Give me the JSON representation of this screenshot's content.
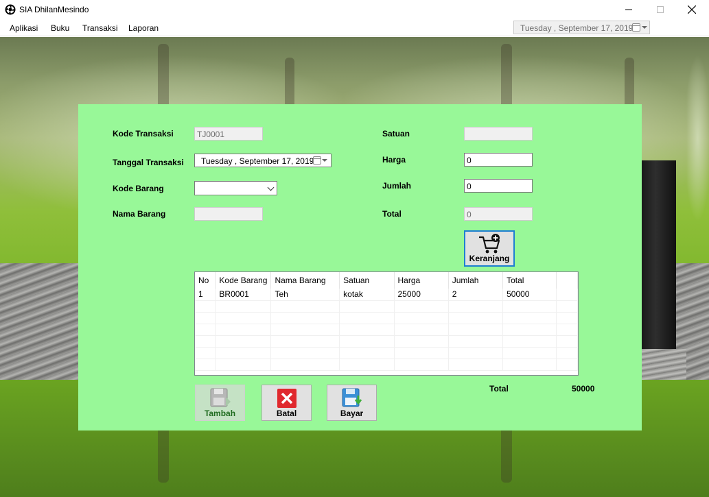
{
  "window": {
    "title": "SIA DhilanMesindo"
  },
  "menu": {
    "items": [
      "Aplikasi",
      "Buku",
      "Transaksi",
      "Laporan"
    ],
    "date_display": "Tuesday   , September 17, 2019"
  },
  "form": {
    "kode_transaksi": {
      "label": "Kode Transaksi",
      "value": "TJ0001"
    },
    "tanggal_transaksi": {
      "label": "Tanggal Transaksi",
      "value": "Tuesday   , September 17, 2019"
    },
    "kode_barang": {
      "label": "Kode Barang",
      "value": ""
    },
    "nama_barang": {
      "label": "Nama Barang",
      "value": ""
    },
    "satuan": {
      "label": "Satuan",
      "value": ""
    },
    "harga": {
      "label": "Harga",
      "value": "0"
    },
    "jumlah": {
      "label": "Jumlah",
      "value": "0"
    },
    "total": {
      "label": "Total",
      "value": "0"
    }
  },
  "buttons": {
    "keranjang": "Keranjang",
    "tambah": "Tambah",
    "batal": "Batal",
    "bayar": "Bayar"
  },
  "table": {
    "columns": [
      "No",
      "Kode Barang",
      "Nama Barang",
      "Satuan",
      "Harga",
      "Jumlah",
      "Total"
    ],
    "rows": [
      [
        "1",
        "BR0001",
        "Teh",
        "kotak",
        "25000",
        "2",
        "50000"
      ]
    ]
  },
  "summary": {
    "total_label": "Total",
    "total_value": "50000"
  },
  "colors": {
    "panel_bg": "#98f898",
    "focus_border": "#1e7fd1",
    "batal_red": "#e0282e"
  }
}
